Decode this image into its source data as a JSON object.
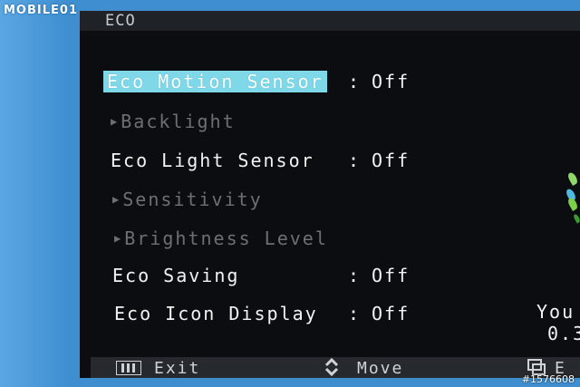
{
  "watermark": {
    "brand": "MOBILE01",
    "image_id": "#1576608"
  },
  "osd": {
    "title": "ECO",
    "items": [
      {
        "label": "Eco Motion Sensor",
        "value": "Off",
        "state": "selected"
      },
      {
        "label": "Backlight",
        "value": "",
        "state": "disabled",
        "submenu": true
      },
      {
        "label": "Eco Light Sensor",
        "value": "Off",
        "state": "normal"
      },
      {
        "label": "Sensitivity",
        "value": "",
        "state": "disabled",
        "submenu": true
      },
      {
        "label": "Brightness Level",
        "value": "",
        "state": "disabled",
        "submenu": true
      },
      {
        "label": "Eco Saving",
        "value": "Off",
        "state": "normal"
      },
      {
        "label": "Eco Icon Display",
        "value": "Off",
        "state": "normal"
      }
    ],
    "colon": ":",
    "side_panel": {
      "text_line1": "You",
      "text_line2": "0.3"
    },
    "footer": {
      "exit_label": "Exit",
      "move_label": "Move",
      "third_label": "E",
      "exit_icon": "menu-grid-icon",
      "move_icon": "up-down-icon",
      "third_icon": "input-icon"
    },
    "colors": {
      "selected_bg": "#7fd8e8",
      "text": "#f2f2f2",
      "disabled_text": "#6c6f73",
      "panel_bg": "#0b0d10",
      "header_bg": "#1f2226",
      "footer_bg": "#26292d",
      "outer_bg": "#3f8fd0"
    }
  }
}
